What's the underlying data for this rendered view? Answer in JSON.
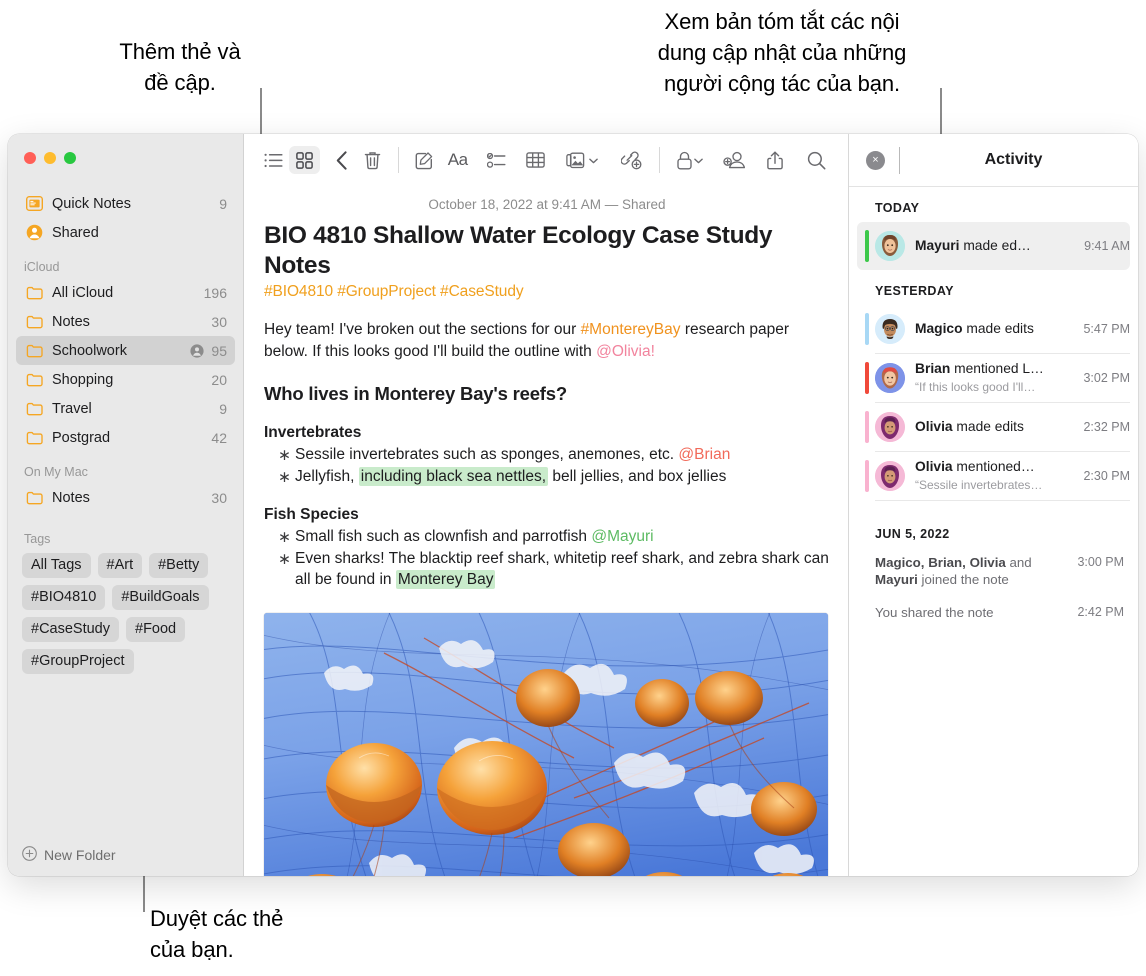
{
  "callouts": [
    {
      "id": "tags-mentions",
      "text": "Thêm thẻ và\nđề cập."
    },
    {
      "id": "collaborator-updates",
      "text": "Xem bản tóm tắt các nội\ndung cập nhật của những\nngười cộng tác của bạn."
    },
    {
      "id": "browse-tags",
      "text": "Duyệt các thẻ\ncủa bạn."
    }
  ],
  "sidebar": {
    "top_items": [
      {
        "icon": "quick-notes-icon",
        "label": "Quick Notes",
        "count": "9"
      },
      {
        "icon": "shared-person-icon",
        "label": "Shared",
        "count": ""
      }
    ],
    "sections": [
      {
        "title": "iCloud",
        "items": [
          {
            "icon": "folder-icon",
            "label": "All iCloud",
            "count": "196",
            "shared": false,
            "selected": false
          },
          {
            "icon": "folder-icon",
            "label": "Notes",
            "count": "30",
            "shared": false,
            "selected": false
          },
          {
            "icon": "folder-icon",
            "label": "Schoolwork",
            "count": "95",
            "shared": true,
            "selected": true
          },
          {
            "icon": "folder-icon",
            "label": "Shopping",
            "count": "20",
            "shared": false,
            "selected": false
          },
          {
            "icon": "folder-icon",
            "label": "Travel",
            "count": "9",
            "shared": false,
            "selected": false
          },
          {
            "icon": "folder-icon",
            "label": "Postgrad",
            "count": "42",
            "shared": false,
            "selected": false
          }
        ]
      },
      {
        "title": "On My Mac",
        "items": [
          {
            "icon": "folder-icon",
            "label": "Notes",
            "count": "30",
            "shared": false,
            "selected": false
          }
        ]
      }
    ],
    "tags_header": "Tags",
    "tags": [
      "All Tags",
      "#Art",
      "#Betty",
      "#BIO4810",
      "#BuildGoals",
      "#CaseStudy",
      "#Food",
      "#GroupProject"
    ],
    "new_folder_label": "New Folder"
  },
  "toolbar": {
    "left": [
      {
        "name": "list-view-icon",
        "label": "List View"
      },
      {
        "name": "gallery-view-icon",
        "label": "Gallery View"
      },
      {
        "name": "back-chevron-icon",
        "label": "Back"
      }
    ],
    "right": [
      {
        "name": "trash-icon",
        "label": "Delete"
      },
      {
        "name": "compose-icon",
        "label": "New Note"
      },
      {
        "name": "format-aa-icon",
        "label": "Aa"
      },
      {
        "name": "checklist-icon",
        "label": "Checklist"
      },
      {
        "name": "table-icon",
        "label": "Table"
      },
      {
        "name": "media-icon",
        "label": "Media"
      },
      {
        "name": "quick-note-link-icon",
        "label": "Add Link"
      },
      {
        "name": "lock-icon",
        "label": "Lock Note"
      },
      {
        "name": "add-collaborator-icon",
        "label": "Add People"
      },
      {
        "name": "share-icon",
        "label": "Share"
      },
      {
        "name": "search-icon",
        "label": "Search"
      }
    ]
  },
  "note": {
    "date_line": "October 18, 2022 at 9:41 AM — Shared",
    "title": "BIO 4810 Shallow Water Ecology Case Study Notes",
    "tags_line": "#BIO4810 #GroupProject #CaseStudy",
    "intro": {
      "part1": "Hey team! I've broken out the sections for our ",
      "hashtag": "#MontereyBay",
      "part2": " research paper below. If this looks good I'll build the outline with ",
      "mention": "@Olivia!"
    },
    "heading": "Who lives in Monterey Bay's reefs?",
    "sections": [
      {
        "subheading": "Invertebrates",
        "bullets": [
          {
            "pre": "Sessile invertebrates such as sponges, anemones, etc. ",
            "mention": "@Brian",
            "mention_color": "red",
            "post": "",
            "highlight": ""
          },
          {
            "pre": "Jellyfish, ",
            "highlight": "including black sea nettles,",
            "post": " bell jellies, and box jellies"
          }
        ]
      },
      {
        "subheading": "Fish Species",
        "bullets": [
          {
            "pre": "Small fish such as clownfish and parrotfish ",
            "mention": "@Mayuri",
            "mention_color": "green",
            "post": "",
            "highlight": ""
          },
          {
            "pre": "Even sharks! The blacktip reef shark, whitetip reef shark, and zebra shark can all be found in ",
            "highlight": "Monterey Bay",
            "post": ""
          }
        ]
      }
    ],
    "image_alt": "jellyfish-photo"
  },
  "activity": {
    "title": "Activity",
    "close_label": "×",
    "groups": [
      {
        "header": "TODAY",
        "items": [
          {
            "avatar": "mayuri-avatar",
            "bar_color": "#3cc84a",
            "avatar_bg": "#b9e8e6",
            "name": "Mayuri",
            "action": " made ed…",
            "quote": "",
            "time": "9:41 AM",
            "selected": true
          }
        ]
      },
      {
        "header": "YESTERDAY",
        "items": [
          {
            "avatar": "magico-avatar",
            "bar_color": "#a8d8f5",
            "avatar_bg": "#d6ecfb",
            "name": "Magico",
            "action": " made edits",
            "quote": "",
            "time": "5:47 PM",
            "selected": false
          },
          {
            "avatar": "brian-avatar",
            "bar_color": "#f0493a",
            "avatar_bg": "#7e93e8",
            "name": "Brian",
            "action": " mentioned L…",
            "quote": "“If this looks good I'll…",
            "time": "3:02 PM",
            "selected": false
          },
          {
            "avatar": "olivia-avatar",
            "bar_color": "#f9b2cf",
            "avatar_bg": "#f5b9d6",
            "name": "Olivia",
            "action": " made edits",
            "quote": "",
            "time": "2:32 PM",
            "selected": false
          },
          {
            "avatar": "olivia-avatar",
            "bar_color": "#f9b2cf",
            "avatar_bg": "#f5b9d6",
            "name": "Olivia",
            "action": " mentioned…",
            "quote": "“Sessile invertebrates…",
            "time": "2:30 PM",
            "selected": false
          }
        ]
      }
    ],
    "history": {
      "header": "JUN 5, 2022",
      "rows": [
        {
          "bold": "Magico, Brian, Olivia",
          "rest": " and ",
          "bold2": "Mayuri",
          "rest2": " joined the note",
          "time": "3:00 PM"
        },
        {
          "bold": "",
          "rest": "You shared the note",
          "bold2": "",
          "rest2": "",
          "time": "2:42 PM"
        }
      ]
    }
  },
  "colors": {
    "accent_orange": "#f0a01e",
    "highlight_green": "#c9ebcb",
    "selection_gray": "#d2d2d2",
    "sidebar_bg": "#e9e9e9"
  }
}
